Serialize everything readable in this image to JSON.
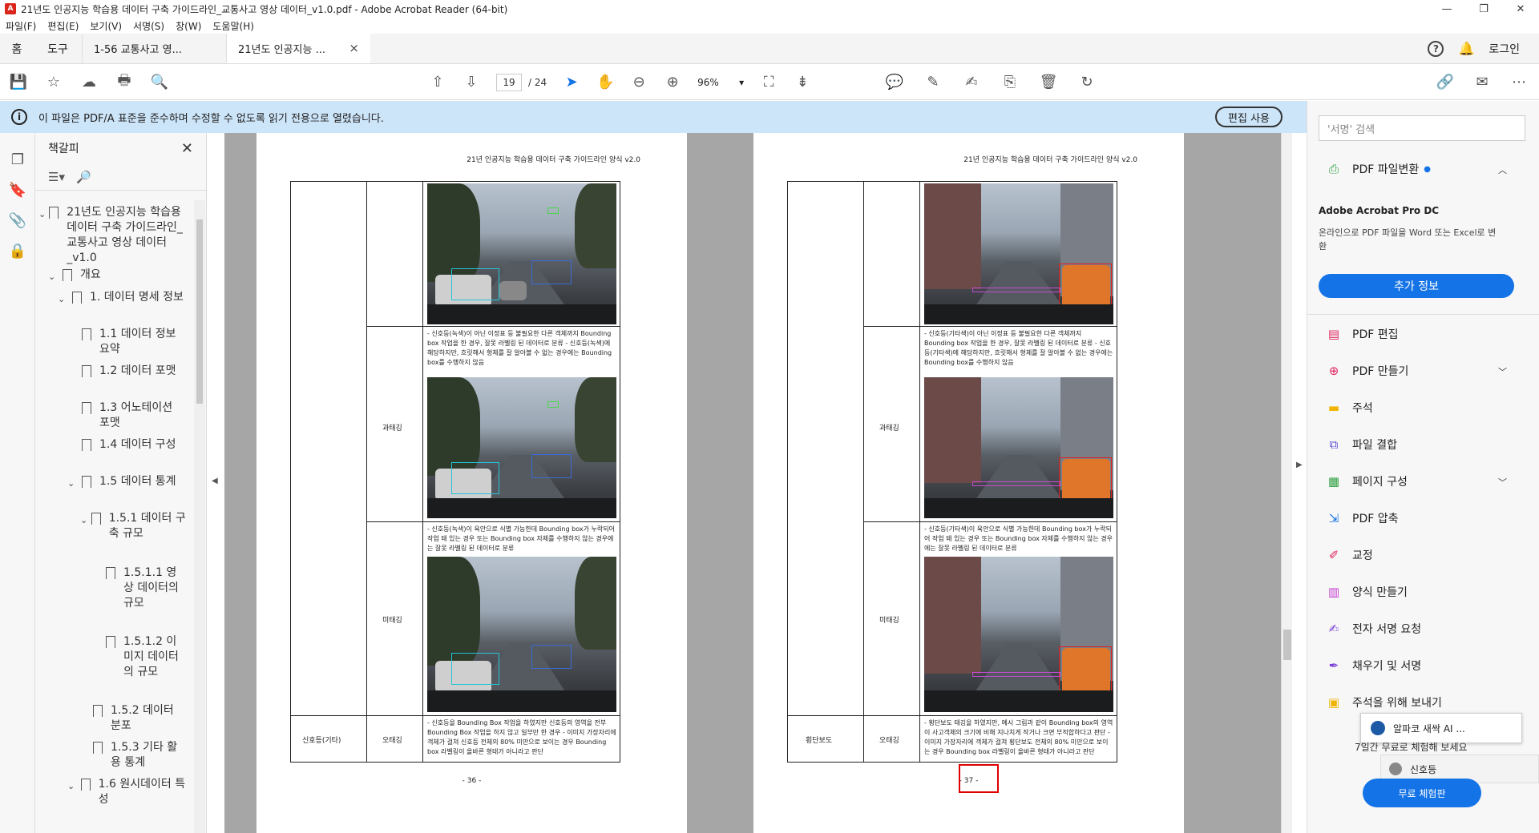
{
  "window": {
    "title": "21년도 인공지능 학습용 데이터 구축 가이드라인_교통사고 영상 데이터_v1.0.pdf - Adobe Acrobat Reader (64-bit)",
    "minimize": "—",
    "maximize": "❐",
    "close": "✕"
  },
  "menu": [
    "파일(F)",
    "편집(E)",
    "보기(V)",
    "서명(S)",
    "창(W)",
    "도움말(H)"
  ],
  "tabs": {
    "home": "홈",
    "tools": "도구",
    "doc1": "1-56 교통사고 영...",
    "doc2": "21년도 인공지능 ...",
    "close": "×",
    "help": "?",
    "login": "로그인"
  },
  "toolbar": {
    "page_current": "19",
    "page_total": "/ 24",
    "zoom": "96%"
  },
  "infobar": {
    "message": "이 파일은 PDF/A 표준을 준수하며 수정할 수 없도록 읽기 전용으로 열렸습니다.",
    "edit_button": "편집 사용"
  },
  "bookmarks": {
    "title": "책갈피",
    "items": [
      {
        "label": "21년도 인공지능 학습용 데이터 구축 가이드라인_교통사고 영상 데이터_v1.0"
      },
      {
        "label": "개요"
      },
      {
        "label": "1. 데이터 명세 정보"
      },
      {
        "label": "1.1 데이터 정보 요약"
      },
      {
        "label": "1.2 데이터 포맷"
      },
      {
        "label": "1.3 어노테이션 포맷"
      },
      {
        "label": "1.4 데이터 구성"
      },
      {
        "label": "1.5 데이터 통계"
      },
      {
        "label": "1.5.1 데이터 구축 규모"
      },
      {
        "label": "1.5.1.1 영상 데이터의 규모"
      },
      {
        "label": "1.5.1.2 이미지 데이터의 규모"
      },
      {
        "label": "1.5.2 데이터 분포"
      },
      {
        "label": "1.5.3 기타 활용 통계"
      },
      {
        "label": "1.6 원시데이터 특성"
      }
    ]
  },
  "pages": {
    "left": {
      "header": "21년 인공지능 학습용 데이터 구축 가이드라인 양식 v2.0",
      "row_label_over": "과태깅",
      "row_label_under": "미태깅",
      "row_label_wrong": "오태깅",
      "category": "신호등(기타)",
      "text_over": "- 신호등(녹색)이 아닌 이정표 등 불필요한 다른 객체까지 Bounding box 작업을 한 경우, 잘못 라벨링 된 데이터로 분류 - 신호등(녹색)에 해당하지만, 흐릿해서 형체를 잘 알아볼 수 없는 경우에는 Bounding box를 수행하지 않음",
      "text_under": "- 신호등(녹색)이 육안으로 식별 가능한데 Bounding box가 누락되어 작업 돼 있는 경우 또는 Bounding box 자체를 수행하지 않는 경우에는 잘못 라벨링 된 데이터로 분류",
      "text_wrong": "- 신호등을 Bounding Box 작업을 하였지만 신호등의 영역을 전부 Bounding Box 작업을 하지 않고 일부만 한 경우 - 이미지 가장자리에 객체가 걸쳐 신호등 전체의 80% 미만으로 보이는 경우 Bounding box 라벨링이 올바른 형태가 아니라고 판단",
      "page_number": "- 36 -"
    },
    "right": {
      "header": "21년 인공지능 학습용 데이터 구축 가이드라인 양식 v2.0",
      "row_label_over": "과태깅",
      "row_label_under": "미태깅",
      "row_label_wrong": "오태깅",
      "category": "횡단보도",
      "text_over": "- 신호등(기타색)이 아닌 이정표 등 불필요한 다른 객체까지 Bounding box 작업을 한 경우, 잘못 라벨링 된 데이터로 분류 - 신호등(기타색)에 해당하지만, 흐릿해서 형체를 잘 알아볼 수 없는 경우에는 Bounding box를 수행하지 않음",
      "text_under": "- 신호등(기타색)이 육안으로 식별 가능한데 Bounding box가 누락되어 작업 돼 있는 경우 또는 Bounding box 자체를 수행하지 않는 경우에는 잘못 라벨링 된 데이터로 분류",
      "text_wrong": "- 횡단보도 태깅을 하였지만, 예시 그림과 같이 Bounding box의 영역이 사고객체의 크기에 비해 지나치게 작거나 크면 부적합하다고 판단 - 이미지 가장자리에 객체가 걸쳐 횡단보도 전체의 80% 미만으로 보이는 경우 Bounding box 라벨링이 올바른 형태가 아니라고 판단",
      "page_number": "- 37 -"
    }
  },
  "right_panel": {
    "search_placeholder": "'서명' 검색",
    "convert": "PDF 파일변환",
    "promo_title": "Adobe Acrobat Pro DC",
    "promo_text": "온라인으로 PDF 파일을 Word 또는 Excel로 변환",
    "promo_button": "추가 정보",
    "tools": [
      {
        "label": "PDF 편집",
        "color": "#e0245e"
      },
      {
        "label": "PDF 만들기",
        "color": "#e0245e"
      },
      {
        "label": "주석",
        "color": "#f0b400"
      },
      {
        "label": "파일 결합",
        "color": "#5b4fd6"
      },
      {
        "label": "페이지 구성",
        "color": "#2d9f3e"
      },
      {
        "label": "PDF 압축",
        "color": "#1473e6"
      },
      {
        "label": "교정",
        "color": "#e0245e"
      },
      {
        "label": "양식 만들기",
        "color": "#c43bd1"
      },
      {
        "label": "전자 서명 요청",
        "color": "#7a3fd6"
      },
      {
        "label": "채우기 및 서명",
        "color": "#7a3fd6"
      },
      {
        "label": "주석을 위해 보내기",
        "color": "#f0b400"
      }
    ],
    "trial_text": "7일간 무료로 체험해 보세요",
    "trial_button": "무료 체험판"
  },
  "popups": {
    "p1": "알파코 새싹 AI ...",
    "p2": "신호등"
  }
}
